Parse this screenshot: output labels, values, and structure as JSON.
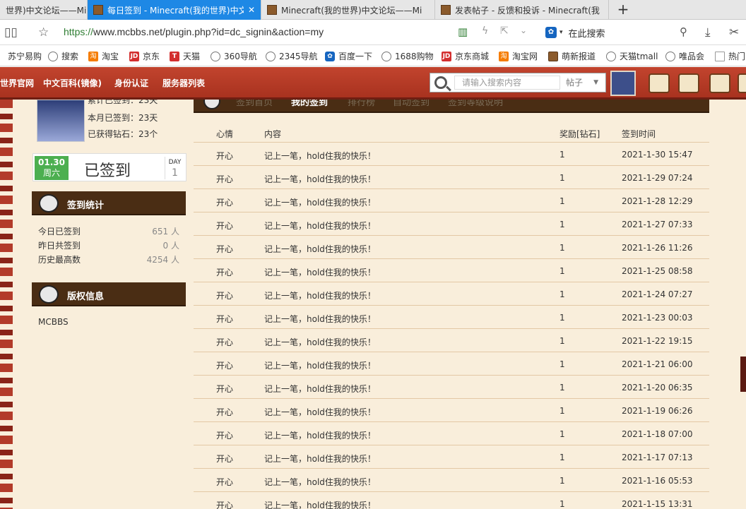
{
  "browser": {
    "tabs": [
      {
        "title": "世界)中文论坛——Mi",
        "active": false
      },
      {
        "title": "每日签到 - Minecraft(我的世界)中文",
        "active": true
      },
      {
        "title": "Minecraft(我的世界)中文论坛——Mi",
        "active": false
      },
      {
        "title": "发表帖子 - 反馈和投诉 - Minecraft(我",
        "active": false
      }
    ],
    "url_scheme": "https://",
    "url_rest": "www.mcbbs.net/plugin.php?id=dc_signin&action=my",
    "search_placeholder": "在此搜索",
    "bookmarks": [
      {
        "label": "苏宁易购",
        "icon": "globe-icon"
      },
      {
        "label": "搜索",
        "icon": "globe-icon"
      },
      {
        "label": "淘宝",
        "icon": "taobao-icon"
      },
      {
        "label": "京东",
        "icon": "jd-icon"
      },
      {
        "label": "天猫",
        "icon": "tmall-icon"
      },
      {
        "label": "360导航",
        "icon": "globe-icon"
      },
      {
        "label": "2345导航",
        "icon": "globe-icon"
      },
      {
        "label": "百度一下",
        "icon": "paw-icon"
      },
      {
        "label": "1688购物",
        "icon": "globe-icon"
      },
      {
        "label": "京东商城",
        "icon": "jd-icon"
      },
      {
        "label": "淘宝网",
        "icon": "taobao-icon"
      },
      {
        "label": "萌新报道",
        "icon": "block-icon"
      },
      {
        "label": "天猫tmall",
        "icon": "globe-icon"
      },
      {
        "label": "唯品会",
        "icon": "globe-icon"
      },
      {
        "label": "热门",
        "icon": "page-icon"
      }
    ]
  },
  "site": {
    "nav": [
      "世界官网",
      "中文百科(镜像)",
      "身份认证",
      "服务器列表"
    ],
    "search_placeholder": "请输入搜索内容",
    "search_type": "帖子"
  },
  "profile": {
    "stat_total": "累计已签到：23天",
    "stat_month": "本月已签到：23天",
    "stat_diamonds": "已获得钻石：23个"
  },
  "signin": {
    "date": "01.30",
    "weekday": "周六",
    "status": "已签到",
    "day_label": "DAY",
    "day_value": "1"
  },
  "stats_panel": {
    "title": "签到统计",
    "rows": [
      {
        "label": "今日已签到",
        "value": "651 人"
      },
      {
        "label": "昨日共签到",
        "value": "0 人"
      },
      {
        "label": "历史最高数",
        "value": "4254 人"
      }
    ]
  },
  "copyright_panel": {
    "title": "版权信息",
    "text": "MCBBS"
  },
  "main_tabs": [
    "签到首页",
    "我的签到",
    "排行榜",
    "自动签到",
    "签到等级说明"
  ],
  "main_tab_active": "我的签到",
  "table": {
    "headers": [
      "心情",
      "内容",
      "奖励[钻石]",
      "签到时间"
    ],
    "rows": [
      [
        "开心",
        "记上一笔，hold住我的快乐！",
        "1",
        "2021-1-30 15:47"
      ],
      [
        "开心",
        "记上一笔，hold住我的快乐！",
        "1",
        "2021-1-29 07:24"
      ],
      [
        "开心",
        "记上一笔，hold住我的快乐！",
        "1",
        "2021-1-28 12:29"
      ],
      [
        "开心",
        "记上一笔，hold住我的快乐！",
        "1",
        "2021-1-27 07:33"
      ],
      [
        "开心",
        "记上一笔，hold住我的快乐！",
        "1",
        "2021-1-26 11:26"
      ],
      [
        "开心",
        "记上一笔，hold住我的快乐！",
        "1",
        "2021-1-25 08:58"
      ],
      [
        "开心",
        "记上一笔，hold住我的快乐！",
        "1",
        "2021-1-24 07:27"
      ],
      [
        "开心",
        "记上一笔，hold住我的快乐！",
        "1",
        "2021-1-23 00:03"
      ],
      [
        "开心",
        "记上一笔，hold住我的快乐！",
        "1",
        "2021-1-22 19:15"
      ],
      [
        "开心",
        "记上一笔，hold住我的快乐！",
        "1",
        "2021-1-21 06:00"
      ],
      [
        "开心",
        "记上一笔，hold住我的快乐！",
        "1",
        "2021-1-20 06:35"
      ],
      [
        "开心",
        "记上一笔，hold住我的快乐！",
        "1",
        "2021-1-19 06:26"
      ],
      [
        "开心",
        "记上一笔，hold住我的快乐！",
        "1",
        "2021-1-18 07:00"
      ],
      [
        "开心",
        "记上一笔，hold住我的快乐！",
        "1",
        "2021-1-17 07:13"
      ],
      [
        "开心",
        "记上一笔，hold住我的快乐！",
        "1",
        "2021-1-16 05:53"
      ],
      [
        "开心",
        "记上一笔，hold住我的快乐！",
        "1",
        "2021-1-15 13:31"
      ]
    ]
  },
  "colors": {
    "active_tab": "#1e88e5",
    "nav_red": "#b33b2a",
    "panel_brown": "#4a2d14",
    "page_bg": "#f9eedb",
    "sign_green": "#4caf50"
  }
}
